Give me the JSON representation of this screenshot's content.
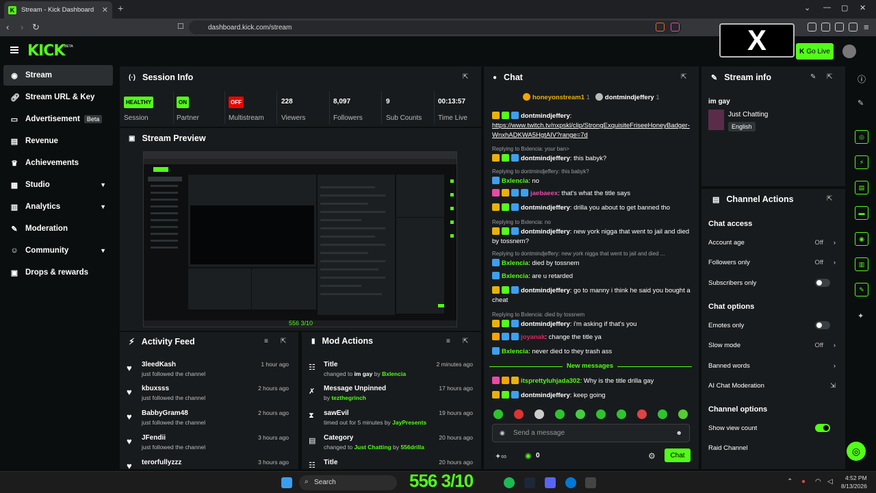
{
  "browser": {
    "tab_title": "Stream - Kick Dashboard",
    "url": "dashboard.kick.com/stream"
  },
  "header": {
    "logo": "KICK",
    "logo_beta": "BETA",
    "go_live": "Go Live",
    "overlay_logo": "X"
  },
  "sidebar": {
    "items": [
      {
        "label": "Stream",
        "icon": "broadcast-icon"
      },
      {
        "label": "Stream URL & Key",
        "icon": "link-icon"
      },
      {
        "label": "Advertisement",
        "icon": "ad-icon",
        "tag": "Beta"
      },
      {
        "label": "Revenue",
        "icon": "chart-icon"
      },
      {
        "label": "Achievements",
        "icon": "trophy-icon"
      },
      {
        "label": "Studio",
        "icon": "studio-icon"
      },
      {
        "label": "Analytics",
        "icon": "analytics-icon"
      },
      {
        "label": "Moderation",
        "icon": "wrench-icon"
      },
      {
        "label": "Community",
        "icon": "people-icon"
      },
      {
        "label": "Drops & rewards",
        "icon": "gift-icon"
      }
    ]
  },
  "session": {
    "title": "Session Info",
    "stats": [
      {
        "value": "HEALTHY",
        "label": "Session",
        "kind": "badge-green"
      },
      {
        "value": "ON",
        "label": "Partner",
        "kind": "badge-green"
      },
      {
        "value": "OFF",
        "label": "Multistream",
        "kind": "badge-red"
      },
      {
        "value": "228",
        "label": "Viewers"
      },
      {
        "value": "8,097",
        "label": "Followers"
      },
      {
        "value": "9",
        "label": "Sub Counts"
      },
      {
        "value": "00:13:57",
        "label": "Time Live"
      }
    ]
  },
  "preview": {
    "title": "Stream Preview"
  },
  "activity": {
    "title": "Activity Feed",
    "items": [
      {
        "name": "3leedKash",
        "text": "just followed the channel",
        "time": "1 hour ago"
      },
      {
        "name": "kbuxsss",
        "text": "just followed the channel",
        "time": "2 hours ago"
      },
      {
        "name": "BabbyGram48",
        "text": "just followed the channel",
        "time": "2 hours ago"
      },
      {
        "name": "JFendii",
        "text": "just followed the channel",
        "time": "3 hours ago"
      },
      {
        "name": "terorfullyzzz",
        "text": "",
        "time": "3 hours ago"
      }
    ]
  },
  "mod": {
    "title": "Mod Actions",
    "items": [
      {
        "title": "Title",
        "pre": "changed to ",
        "mid": "im gay",
        "by": " by ",
        "user": "Bxlencia",
        "time": "2 minutes ago"
      },
      {
        "title": "Message Unpinned",
        "pre": "by ",
        "mid": "",
        "by": "",
        "user": "tezthegrinch",
        "time": "17 hours ago"
      },
      {
        "title": "sawEvil",
        "pre": "timed out for 5 minutes by ",
        "mid": "",
        "by": "",
        "user": "JayPresents",
        "time": "19 hours ago"
      },
      {
        "title": "Category",
        "pre": "changed to ",
        "mid": "Just Chatting",
        "by": " by ",
        "user": "556drilla",
        "time": "20 hours ago"
      },
      {
        "title": "Title",
        "pre": "",
        "mid": "",
        "by": "",
        "user": "",
        "time": "20 hours ago"
      }
    ]
  },
  "chat": {
    "title": "Chat",
    "pinned_users": [
      {
        "name": "honeyonstream1",
        "count": "1"
      },
      {
        "name": "dontmindjeffery",
        "count": "1"
      }
    ],
    "messages": [
      {
        "reply": "",
        "user": "dontmindjeffery",
        "color": "#ffffff",
        "text": "https://www.twitch.tv/nxpskl/clip/StrongExquisiteFriseeHoneyBadger-WnxhADKWA5HgtAIV?range=7d"
      },
      {
        "reply": "Replying to Bxlencia: your ban>",
        "user": "dontmindjeffery",
        "color": "#ffffff",
        "text": "this babyk?"
      },
      {
        "reply": "Replying to dontmindjeffery: this babyk?",
        "user": "Bxlencia",
        "color": "#53fc18",
        "text": "no"
      },
      {
        "reply": "",
        "user": "jaebaeex",
        "color": "#e84aa8",
        "text": "that's what the title says"
      },
      {
        "reply": "",
        "user": "dontmindjeffery",
        "color": "#ffffff",
        "text": "drilla you about to get banned tho"
      },
      {
        "reply": "Replying to Bxlencia: no",
        "user": "dontmindjeffery",
        "color": "#ffffff",
        "text": "new york nigga that went to jail and died by tossnem?"
      },
      {
        "reply": "Replying to dontmindjeffery: new york nigga that went to jail and died ...",
        "user": "Bxlencia",
        "color": "#53fc18",
        "text": "died by tossnem"
      },
      {
        "reply": "",
        "user": "Bxlencia",
        "color": "#53fc18",
        "text": "are u retarded"
      },
      {
        "reply": "",
        "user": "dontmindjeffery",
        "color": "#ffffff",
        "text": "go to manny i think he said you bought a cheat"
      },
      {
        "reply": "Replying to Bxlencia: died by tossnem",
        "user": "dontmindjeffery",
        "color": "#ffffff",
        "text": "i'm asking if that's you"
      },
      {
        "reply": "",
        "user": "joyanak",
        "color": "#e0245e",
        "text": "change the title ya"
      },
      {
        "reply": "",
        "user": "Bxlencia",
        "color": "#53fc18",
        "text": "never died to they trash ass"
      }
    ],
    "new_messages": "New messages",
    "new": [
      {
        "user": "itsprettyluhjada302",
        "color": "#53fc18",
        "text": "Why is the title drilla gay"
      },
      {
        "user": "dontmindjeffery",
        "color": "#ffffff",
        "text": "keep going"
      }
    ],
    "input_placeholder": "Send a message",
    "points": "0",
    "send": "Chat"
  },
  "stream_info": {
    "title": "Stream info",
    "stream_title": "im gay",
    "category": "Just Chatting",
    "language": "English"
  },
  "channel_actions": {
    "title": "Channel Actions",
    "chat_access": "Chat access",
    "account_age": "Account age",
    "account_age_val": "Off",
    "followers_only": "Followers only",
    "followers_only_val": "Off",
    "subscribers_only": "Subscribers only",
    "chat_options": "Chat options",
    "emotes_only": "Emotes only",
    "slow_mode": "Slow mode",
    "slow_mode_val": "Off",
    "banned_words": "Banned words",
    "ai_mod": "AI Chat Moderation",
    "channel_options": "Channel options",
    "show_view_count": "Show view count",
    "raid_channel": "Raid Channel"
  },
  "overlay": {
    "score": "556 3/10"
  },
  "taskbar": {
    "search": "Search",
    "time": "4:52 PM",
    "date": "8/13/2026"
  }
}
